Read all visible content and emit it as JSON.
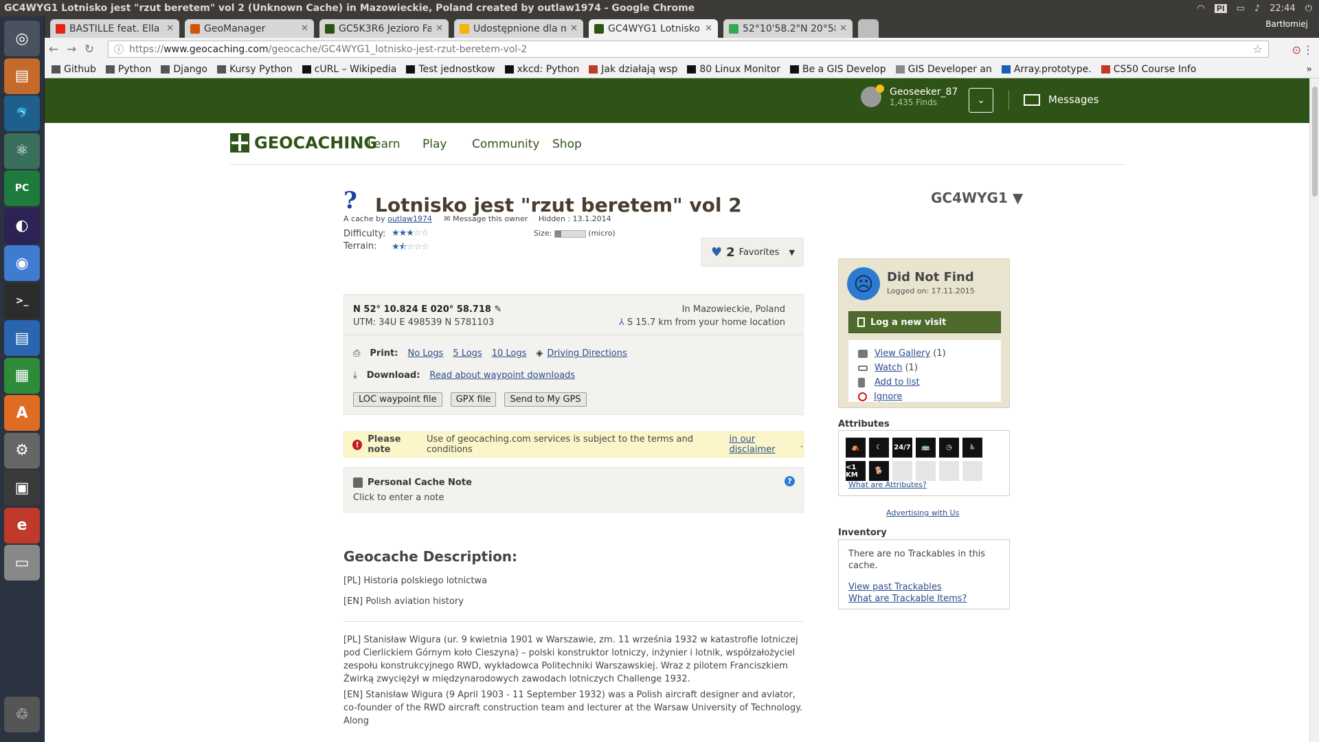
{
  "window": {
    "title": "GC4WYG1 Lotnisko jest \"rzut beretem\" vol 2 (Unknown Cache) in Mazowieckie, Poland created by outlaw1974 - Google Chrome",
    "tray_kbd": "Pl",
    "clock": "22:44"
  },
  "launcher": {
    "items": [
      "ubuntu-dash",
      "files",
      "mysql-workbench",
      "atom",
      "pycharm",
      "eclipse",
      "chrome",
      "terminal",
      "libreoffice-writer",
      "libreoffice-calc",
      "software-center",
      "system-settings",
      "keepass",
      "document-viewer",
      "disk",
      "trash"
    ]
  },
  "browser": {
    "profile": "Bartłomiej",
    "tabs": [
      {
        "title": "BASTILLE feat. Ella",
        "color": "#e62117"
      },
      {
        "title": "GeoManager",
        "color": "#d35400"
      },
      {
        "title": "GC5K3R6 Jezioro Fa",
        "color": "#2f5316"
      },
      {
        "title": "Udostępnione dla m",
        "color": "#f4b400"
      },
      {
        "title": "GC4WYG1 Lotnisko",
        "color": "#2f5316",
        "active": true
      },
      {
        "title": "52°10'58.2\"N 20°58'",
        "color": "#34a853"
      }
    ],
    "url_scheme": "https://",
    "url_host": "www.geocaching.com",
    "url_path": "/geocache/GC4WYG1_lotnisko-jest-rzut-beretem-vol-2",
    "bookmarks": [
      {
        "label": "Github",
        "color": "#555"
      },
      {
        "label": "Python",
        "color": "#555"
      },
      {
        "label": "Django",
        "color": "#555"
      },
      {
        "label": "Kursy Python",
        "color": "#555"
      },
      {
        "label": "cURL – Wikipedia",
        "color": "#111"
      },
      {
        "label": "Test jednostkow",
        "color": "#111"
      },
      {
        "label": "xkcd: Python",
        "color": "#111"
      },
      {
        "label": "Jak działają wsp",
        "color": "#c0392b"
      },
      {
        "label": "80 Linux Monitor",
        "color": "#111"
      },
      {
        "label": "Be a GIS Develop",
        "color": "#111"
      },
      {
        "label": "GIS Developer an",
        "color": "#888"
      },
      {
        "label": "Array.prototype.",
        "color": "#1a5fb4"
      },
      {
        "label": "CS50 Course Info",
        "color": "#c0392b"
      }
    ]
  },
  "site": {
    "user": {
      "name": "Geoseeker_87",
      "finds": "1,435 Finds"
    },
    "messages": "Messages",
    "logo": "GEOCACHING",
    "nav": [
      "Learn",
      "Play",
      "Community",
      "Shop"
    ]
  },
  "cache": {
    "title": "Lotnisko jest \"rzut beretem\" vol 2",
    "code": "GC4WYG1 ▼",
    "byline_prefix": "A cache by",
    "owner": "outlaw1974",
    "message_owner": "Message this owner",
    "hidden": "Hidden : 13.1.2014",
    "difficulty_label": "Difficulty:",
    "terrain_label": "Terrain:",
    "difficulty": 3,
    "terrain": 1.5,
    "size_label": "Size:",
    "size_value": "(micro)",
    "favorites_count": "2",
    "favorites_label": "Favorites",
    "coords": "N 52° 10.824 E 020° 58.718",
    "utm": "UTM: 34U E 498539 N 5781103",
    "location": "In Mazowieckie, Poland",
    "distance": "S 15.7 km from your home location",
    "print_label": "Print:",
    "print_links": [
      "No Logs",
      "5 Logs",
      "10 Logs"
    ],
    "driving": "Driving Directions",
    "download_label": "Download:",
    "download_link": "Read about waypoint downloads",
    "buttons": [
      "LOC waypoint file",
      "GPX file",
      "Send to My GPS"
    ],
    "note_strong": "Please note",
    "note_text": "Use of geocaching.com services is subject to the terms and conditions",
    "note_link": "in our disclaimer",
    "note_end": ".",
    "pcn_title": "Personal Cache Note",
    "pcn_prompt": "Click to enter a note",
    "desc_heading": "Geocache Description:",
    "desc_pl1": "[PL] Historia polskiego lotnictwa",
    "desc_en1": "[EN] Polish aviation history",
    "desc_pl2": "[PL] Stanisław Wigura (ur. 9 kwietnia 1901 w Warszawie, zm. 11 września 1932 w katastrofie lotniczej pod Cierlickiem Górnym koło Cieszyna) – polski konstruktor lotniczy, inżynier i lotnik, współzałożyciel zespołu konstrukcyjnego RWD, wykładowca Politechniki Warszawskiej. Wraz z pilotem Franciszkiem Żwirką zwyciężył w międzynarodowych zawodach lotniczych Challenge 1932.",
    "desc_en2": "[EN] Stanisław Wigura (9 April 1903 - 11 September 1932) was a Polish aircraft designer and aviator, co-founder of the RWD aircraft construction team and lecturer at the Warsaw University of Technology. Along"
  },
  "sidebar": {
    "status": "Did Not Find",
    "logged": "Logged on: 17.11.2015",
    "log_button": "Log a new visit",
    "gallery": "View Gallery",
    "gallery_count": "(1)",
    "watch": "Watch",
    "watch_count": "(1)",
    "add_list": "Add to list",
    "ignore": "Ignore",
    "attributes_heading": "Attributes",
    "attributes": [
      "tourist-icon",
      "night-icon",
      "24/7",
      "bus-icon",
      "clock-icon",
      "wheelchair-icon",
      "<1 KM",
      "dogs-icon"
    ],
    "attributes_link": "What are Attributes?",
    "advertising": "Advertising with Us",
    "inventory_heading": "Inventory",
    "inventory_empty": "There are no Trackables in this cache.",
    "past_trackables": "View past Trackables",
    "what_trackables": "What are Trackable Items?"
  }
}
